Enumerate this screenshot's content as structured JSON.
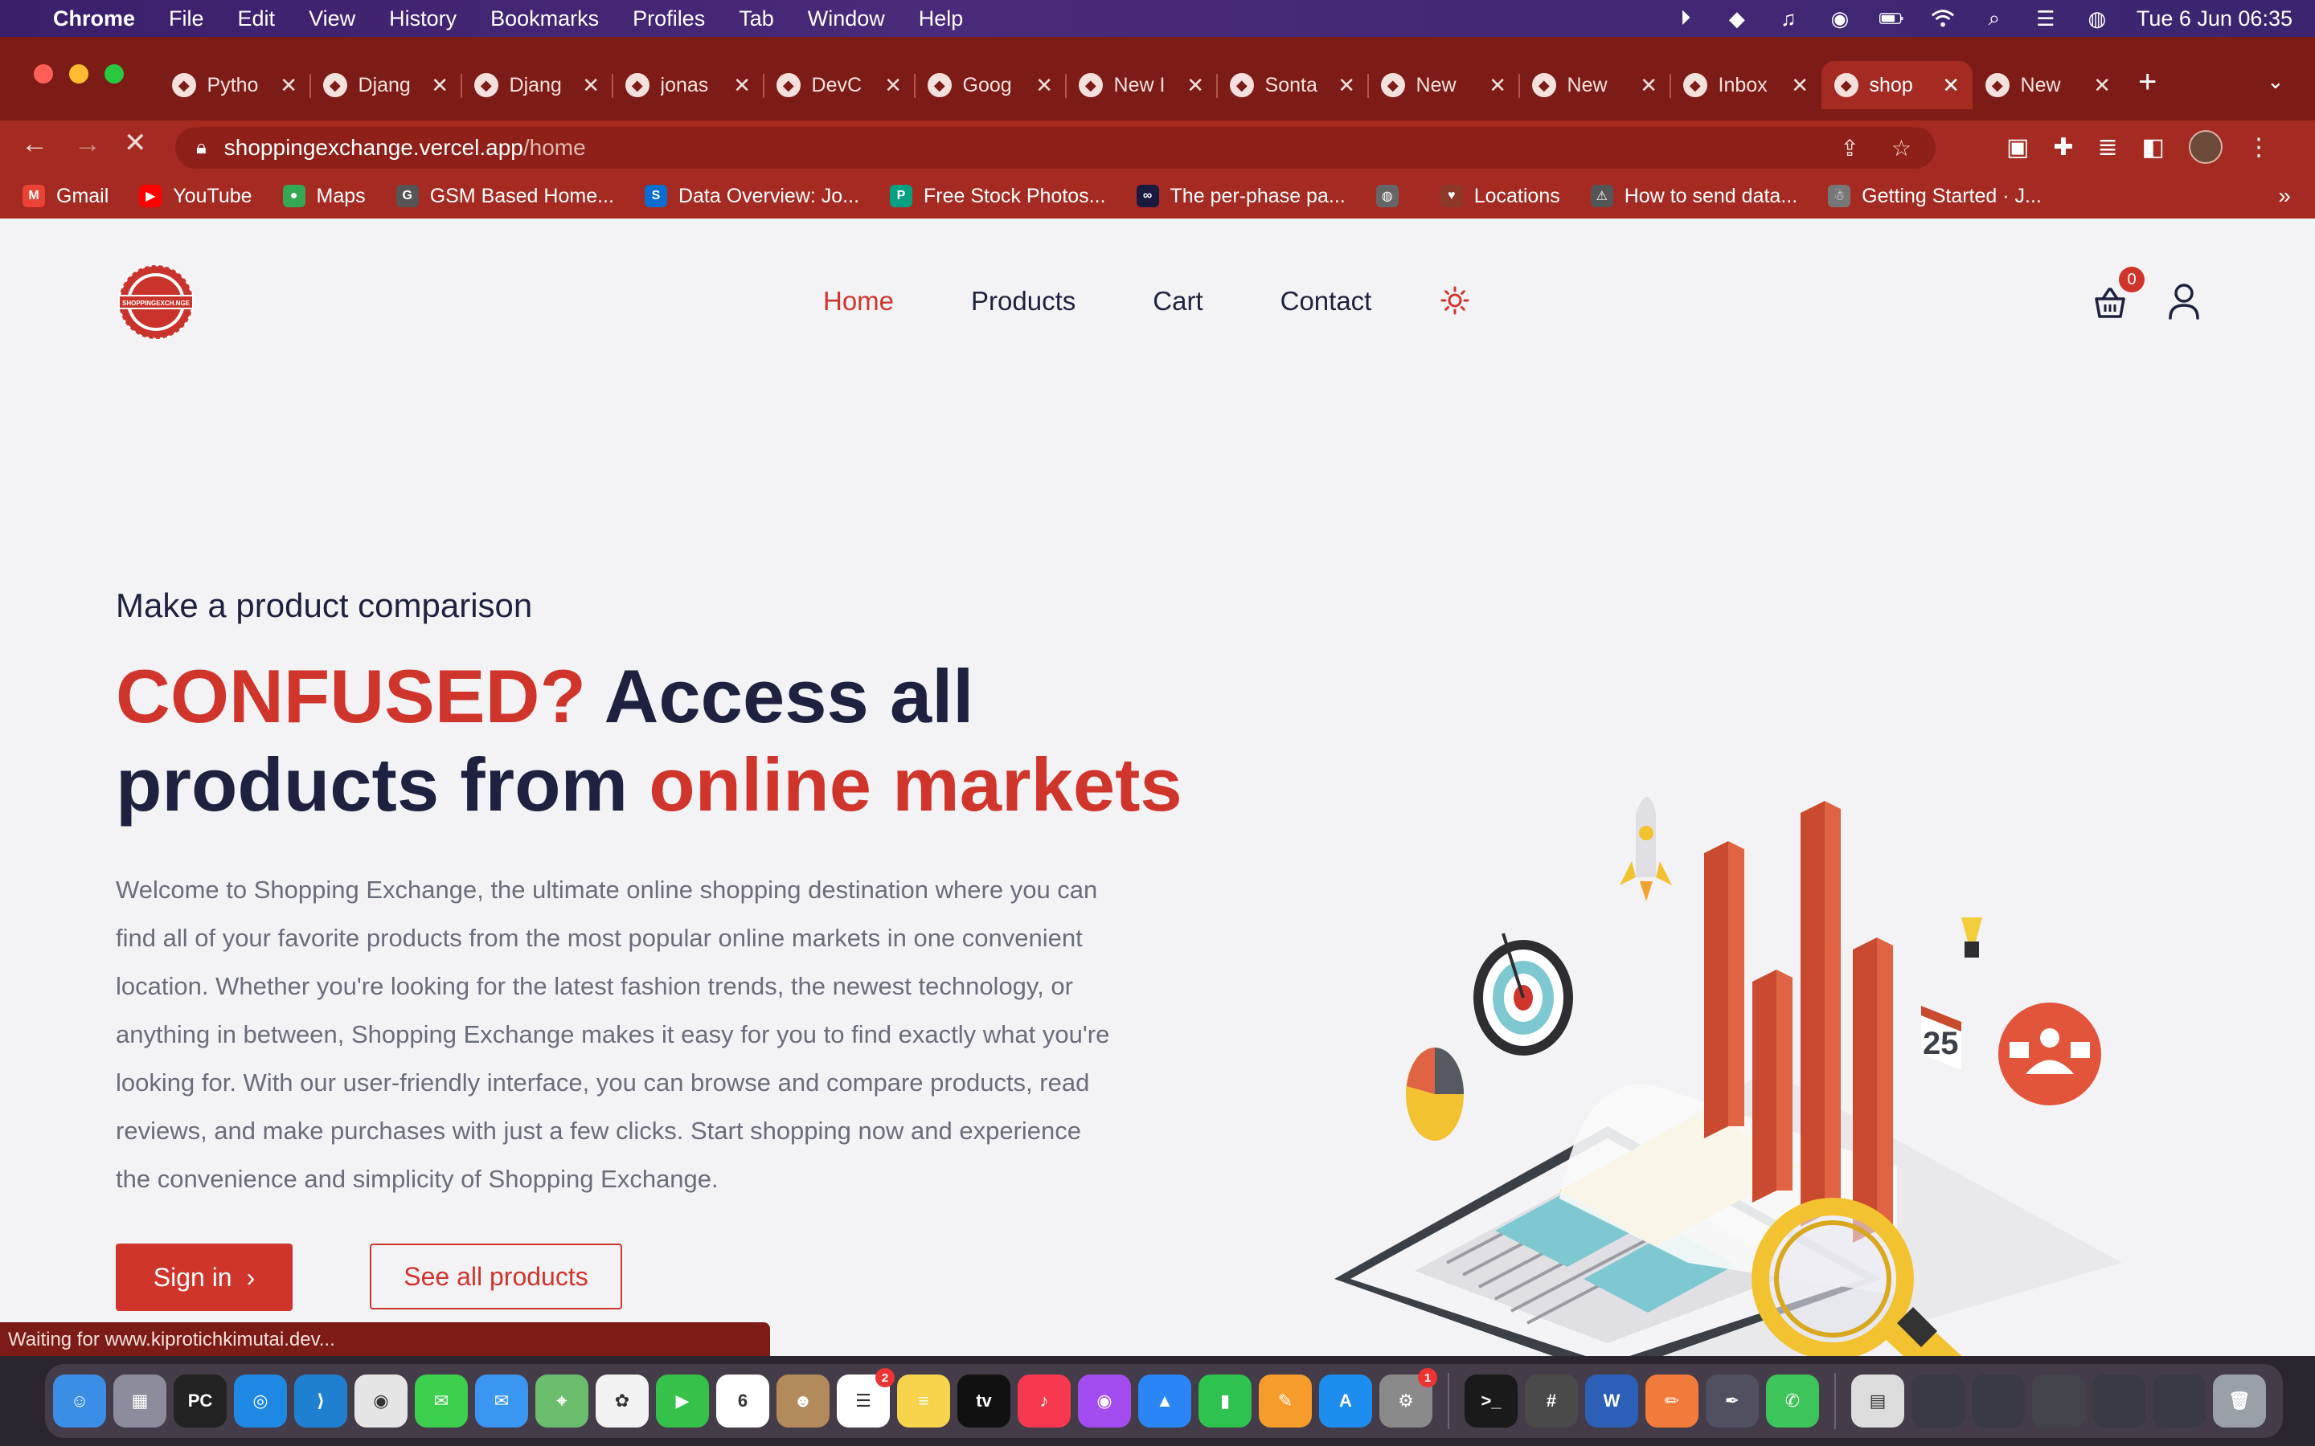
{
  "menubar": {
    "app_name": "Chrome",
    "items": [
      "File",
      "Edit",
      "View",
      "History",
      "Bookmarks",
      "Profiles",
      "Tab",
      "Window",
      "Help"
    ],
    "datetime": "Tue 6 Jun  06:35"
  },
  "tabs": [
    {
      "label": "Pytho",
      "icon": "python-icon"
    },
    {
      "label": "Djang",
      "icon": "github-icon"
    },
    {
      "label": "Djang",
      "icon": "github-icon"
    },
    {
      "label": "jonas",
      "icon": "github-icon"
    },
    {
      "label": "DevC",
      "icon": "globe-icon"
    },
    {
      "label": "Goog",
      "icon": "meet-icon"
    },
    {
      "label": "New I",
      "icon": "mail-icon"
    },
    {
      "label": "Sonta",
      "icon": "github-icon"
    },
    {
      "label": "New",
      "icon": "mail-icon"
    },
    {
      "label": "New",
      "icon": "chrome-icon"
    },
    {
      "label": "Inbox",
      "icon": "gmail-icon"
    },
    {
      "label": "shop",
      "icon": "shop-icon"
    },
    {
      "label": "New",
      "icon": "chrome-icon"
    }
  ],
  "active_tab_index": 11,
  "address": {
    "host": "shoppingexchange.vercel.app",
    "path": "/home"
  },
  "bookmarks": [
    {
      "label": "Gmail",
      "color": "#ea4335",
      "glyph": "M"
    },
    {
      "label": "YouTube",
      "color": "#ff0000",
      "glyph": "▶"
    },
    {
      "label": "Maps",
      "color": "#34a853",
      "glyph": "●"
    },
    {
      "label": "GSM Based Home...",
      "color": "#555555",
      "glyph": "G"
    },
    {
      "label": "Data Overview: Jo...",
      "color": "#0a6ed1",
      "glyph": "S"
    },
    {
      "label": "Free Stock Photos...",
      "color": "#05a081",
      "glyph": "P"
    },
    {
      "label": "The per-phase pa...",
      "color": "#1a1a40",
      "glyph": "∞"
    },
    {
      "label": "",
      "color": "#666666",
      "glyph": "◍"
    },
    {
      "label": "Locations",
      "color": "#8b3a2a",
      "glyph": "♥"
    },
    {
      "label": "How to send data...",
      "color": "#555555",
      "glyph": "⚠"
    },
    {
      "label": "Getting Started · J...",
      "color": "#777777",
      "glyph": "☃"
    }
  ],
  "site": {
    "logo_text": "SHOPPINGEXCH.NGE",
    "nav": [
      "Home",
      "Products",
      "Cart",
      "Contact"
    ],
    "active_nav": "Home",
    "cart_count": "0",
    "hero": {
      "subtitle": "Make a product comparison",
      "title_red_1": "CONFUSED?",
      "title_dark_1": " Access all products from ",
      "title_red_2": "online markets",
      "description": "Welcome to Shopping Exchange, the ultimate online shopping destination where you can find all of your favorite products from the most popular online markets in one convenient location. Whether you're looking for the latest fashion trends, the newest technology, or anything in between, Shopping Exchange makes it easy for you to find exactly what you're looking for. With our user-friendly interface, you can browse and compare products, read reviews, and make purchases with just a few clicks. Start shopping now and experience the convenience and simplicity of Shopping Exchange.",
      "signin_label": "Sign in",
      "products_label": "See all products"
    },
    "art_label": "25"
  },
  "status_text": "Waiting for www.kiprotichkimutai.dev...",
  "dock": [
    {
      "name": "finder-icon",
      "color": "#3a8ee6",
      "glyph": "☺"
    },
    {
      "name": "launchpad-icon",
      "color": "#8c8c9c",
      "glyph": "▦"
    },
    {
      "name": "pycharm-icon",
      "color": "#222222",
      "glyph": "PC"
    },
    {
      "name": "safari-icon",
      "color": "#1e88e5",
      "glyph": "◎"
    },
    {
      "name": "vscode-icon",
      "color": "#1f7fd1",
      "glyph": "⟩"
    },
    {
      "name": "chrome-icon",
      "color": "#e5e5e5",
      "glyph": "◉"
    },
    {
      "name": "messages-icon",
      "color": "#3ccf4e",
      "glyph": "✉"
    },
    {
      "name": "mail-icon",
      "color": "#3a96f0",
      "glyph": "✉"
    },
    {
      "name": "maps-icon",
      "color": "#6bbd6e",
      "glyph": "⌖"
    },
    {
      "name": "photos-icon",
      "color": "#f2f2f2",
      "glyph": "✿"
    },
    {
      "name": "facetime-icon",
      "color": "#35c24a",
      "glyph": "▶"
    },
    {
      "name": "calendar-icon",
      "color": "#ffffff",
      "glyph": "6"
    },
    {
      "name": "contacts-icon",
      "color": "#b28a5c",
      "glyph": "☻"
    },
    {
      "name": "reminders-icon",
      "color": "#ffffff",
      "glyph": "☰",
      "badge": "2"
    },
    {
      "name": "notes-icon",
      "color": "#f7d44c",
      "glyph": "≡"
    },
    {
      "name": "tv-icon",
      "color": "#111111",
      "glyph": "tv"
    },
    {
      "name": "music-icon",
      "color": "#f8384f",
      "glyph": "♪"
    },
    {
      "name": "podcasts-icon",
      "color": "#a24cf0",
      "glyph": "◉"
    },
    {
      "name": "keynote-icon",
      "color": "#2a86f5",
      "glyph": "▲"
    },
    {
      "name": "numbers-icon",
      "color": "#2ec24e",
      "glyph": "▮"
    },
    {
      "name": "pages-icon",
      "color": "#f59c2a",
      "glyph": "✎"
    },
    {
      "name": "appstore-icon",
      "color": "#1e8df0",
      "glyph": "A"
    },
    {
      "name": "settings-icon",
      "color": "#8a8a8a",
      "glyph": "⚙",
      "badge": "1"
    },
    {
      "name": "terminal-icon",
      "color": "#1a1a1a",
      "glyph": ">_"
    },
    {
      "name": "calculator-icon",
      "color": "#4a4a4a",
      "glyph": "#"
    },
    {
      "name": "word-icon",
      "color": "#2b5fb8",
      "glyph": "W"
    },
    {
      "name": "sketch-icon",
      "color": "#f27a3a",
      "glyph": "✏"
    },
    {
      "name": "pen-icon",
      "color": "#505060",
      "glyph": "✒"
    },
    {
      "name": "whatsapp-icon",
      "color": "#3dc45a",
      "glyph": "✆"
    },
    {
      "name": "preview-icon",
      "color": "#dcdcdc",
      "glyph": "▤"
    },
    {
      "name": "window-thumb-1",
      "color": "#3a3a44",
      "glyph": ""
    },
    {
      "name": "window-thumb-2",
      "color": "#3a3a44",
      "glyph": ""
    },
    {
      "name": "window-thumb-3",
      "color": "#44444c",
      "glyph": ""
    },
    {
      "name": "window-thumb-4",
      "color": "#3a3a44",
      "glyph": ""
    },
    {
      "name": "window-thumb-5",
      "color": "#3a3a44",
      "glyph": ""
    },
    {
      "name": "trash-icon",
      "color": "#9aa0a8",
      "glyph": "🗑"
    }
  ],
  "colors": {
    "brand_red": "#d0352b",
    "navy": "#1e2240",
    "chrome_tab": "#7d1b17",
    "chrome_toolbar": "#a52a22"
  }
}
